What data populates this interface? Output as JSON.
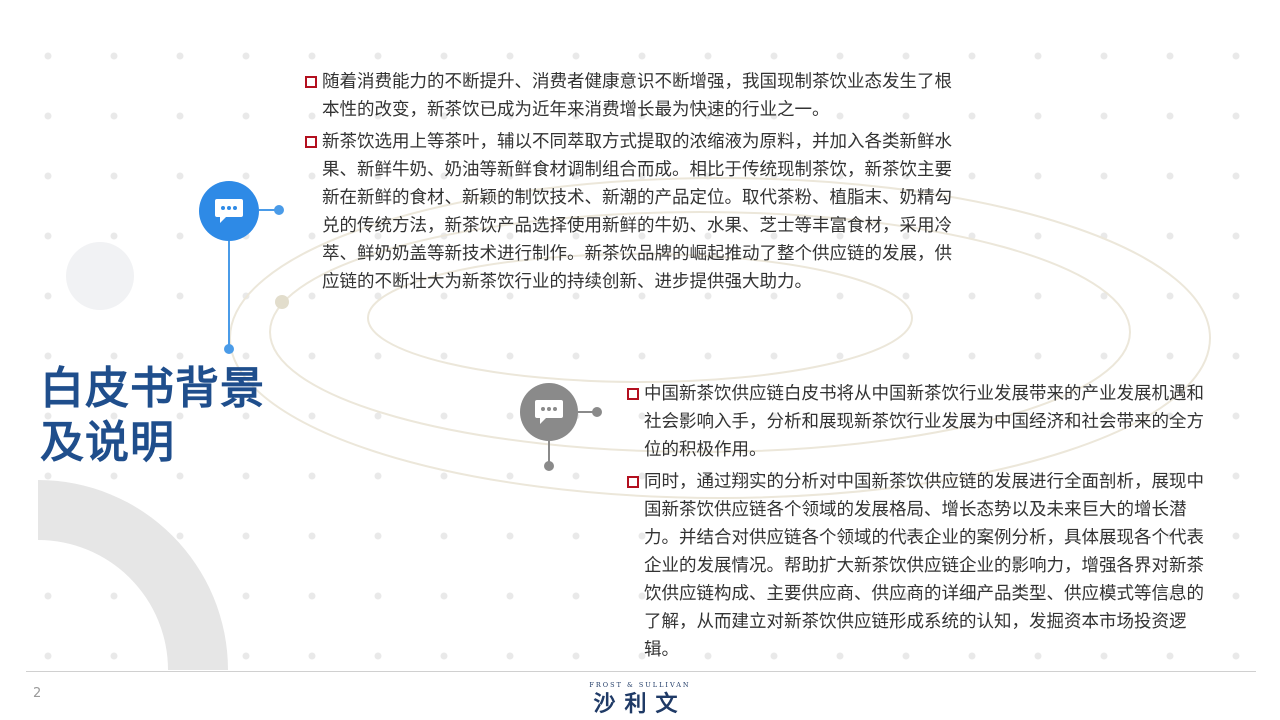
{
  "title": {
    "line1": "白皮书背景",
    "line2": "及说明"
  },
  "block_a": {
    "paragraphs": [
      "随着消费能力的不断提升、消费者健康意识不断增强，我国现制茶饮业态发生了根本性的改变，新茶饮已成为近年来消费增长最为快速的行业之一。",
      "新茶饮选用上等茶叶，辅以不同萃取方式提取的浓缩液为原料，并加入各类新鲜水果、新鲜牛奶、奶油等新鲜食材调制组合而成。相比于传统现制茶饮，新茶饮主要新在新鲜的食材、新颖的制饮技术、新潮的产品定位。取代茶粉、植脂末、奶精勾兑的传统方法，新茶饮产品选择使用新鲜的牛奶、水果、芝士等丰富食材，采用冷萃、鲜奶奶盖等新技术进行制作。新茶饮品牌的崛起推动了整个供应链的发展，供应链的不断壮大为新茶饮行业的持续创新、进步提供强大助力。"
    ]
  },
  "block_b": {
    "paragraphs": [
      "中国新茶饮供应链白皮书将从中国新茶饮行业发展带来的产业发展机遇和社会影响入手，分析和展现新茶饮行业发展为中国经济和社会带来的全方位的积极作用。",
      "同时，通过翔实的分析对中国新茶饮供应链的发展进行全面剖析，展现中国新茶饮供应链各个领域的发展格局、增长态势以及未来巨大的增长潜力。并结合对供应链各个领域的代表企业的案例分析，具体展现各个代表企业的发展情况。帮助扩大新茶饮供应链企业的影响力，增强各界对新茶饮供应链构成、主要供应商、供应商的详细产品类型、供应模式等信息的了解，从而建立对新茶饮供应链形成系统的认知，发掘资本市场投资逻辑。"
    ]
  },
  "icons": {
    "top_badge": "chat-bubble-icon",
    "bottom_badge": "chat-bubble-icon"
  },
  "footer": {
    "page_number": "2",
    "logo_top_text": "FROST & SULLIVAN",
    "logo_main_text": "沙利文"
  },
  "colors": {
    "title": "#1f4e8c",
    "accent_blue": "#2e8ae6",
    "accent_grey": "#8a8a8a",
    "bullet_red": "#b3101f",
    "body_text": "#333333"
  }
}
